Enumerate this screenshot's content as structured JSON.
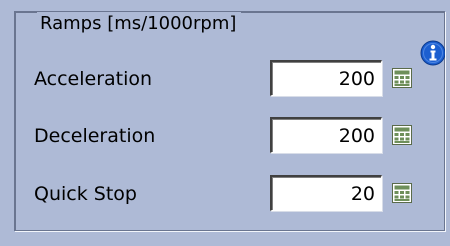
{
  "group": {
    "title": "Ramps [ms/1000rpm]"
  },
  "rows": [
    {
      "label": "Acceleration",
      "value": "200"
    },
    {
      "label": "Deceleration",
      "value": "200"
    },
    {
      "label": "Quick Stop",
      "value": "20"
    }
  ],
  "icons": {
    "info": "info-icon",
    "calculator": "calculator-icon"
  },
  "colors": {
    "background": "#aebad6",
    "info_blue": "#1c5fd0",
    "calc_green": "#6e8f5a"
  }
}
